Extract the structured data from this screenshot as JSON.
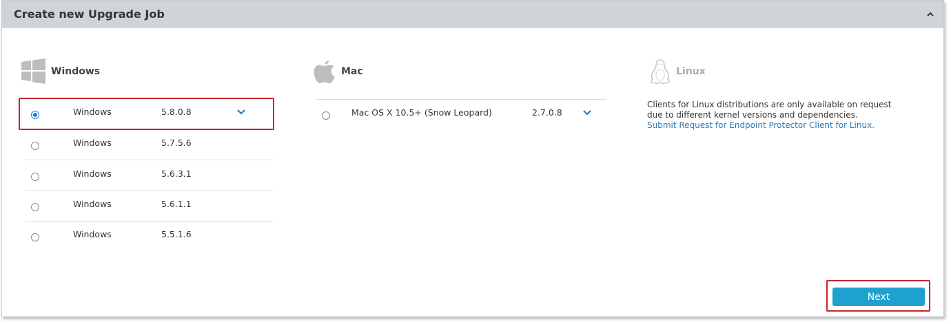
{
  "header": {
    "title": "Create new Upgrade Job"
  },
  "windows": {
    "label": "Windows",
    "rows": [
      {
        "os": "Windows",
        "version": "5.8.0.8",
        "selected": true
      },
      {
        "os": "Windows",
        "version": "5.7.5.6",
        "selected": false
      },
      {
        "os": "Windows",
        "version": "5.6.3.1",
        "selected": false
      },
      {
        "os": "Windows",
        "version": "5.6.1.1",
        "selected": false
      },
      {
        "os": "Windows",
        "version": "5.5.1.6",
        "selected": false
      }
    ]
  },
  "mac": {
    "label": "Mac",
    "rows": [
      {
        "os": "Mac OS X 10.5+ (Snow Leopard)",
        "version": "2.7.0.8",
        "selected": false
      }
    ]
  },
  "linux": {
    "label": "Linux",
    "note": "Clients for Linux distributions are only available on request due to different kernel versions and dependencies.",
    "link": "Submit Request for Endpoint Protector Client for Linux."
  },
  "footer": {
    "next_label": "Next"
  },
  "colors": {
    "accent": "#1ea1d0",
    "highlight": "#c6252b",
    "header_bg": "#cfd4d9"
  },
  "icons": [
    "windows-logo-icon",
    "apple-logo-icon",
    "linux-penguin-icon",
    "chevron-up-icon",
    "chevron-down-icon"
  ]
}
